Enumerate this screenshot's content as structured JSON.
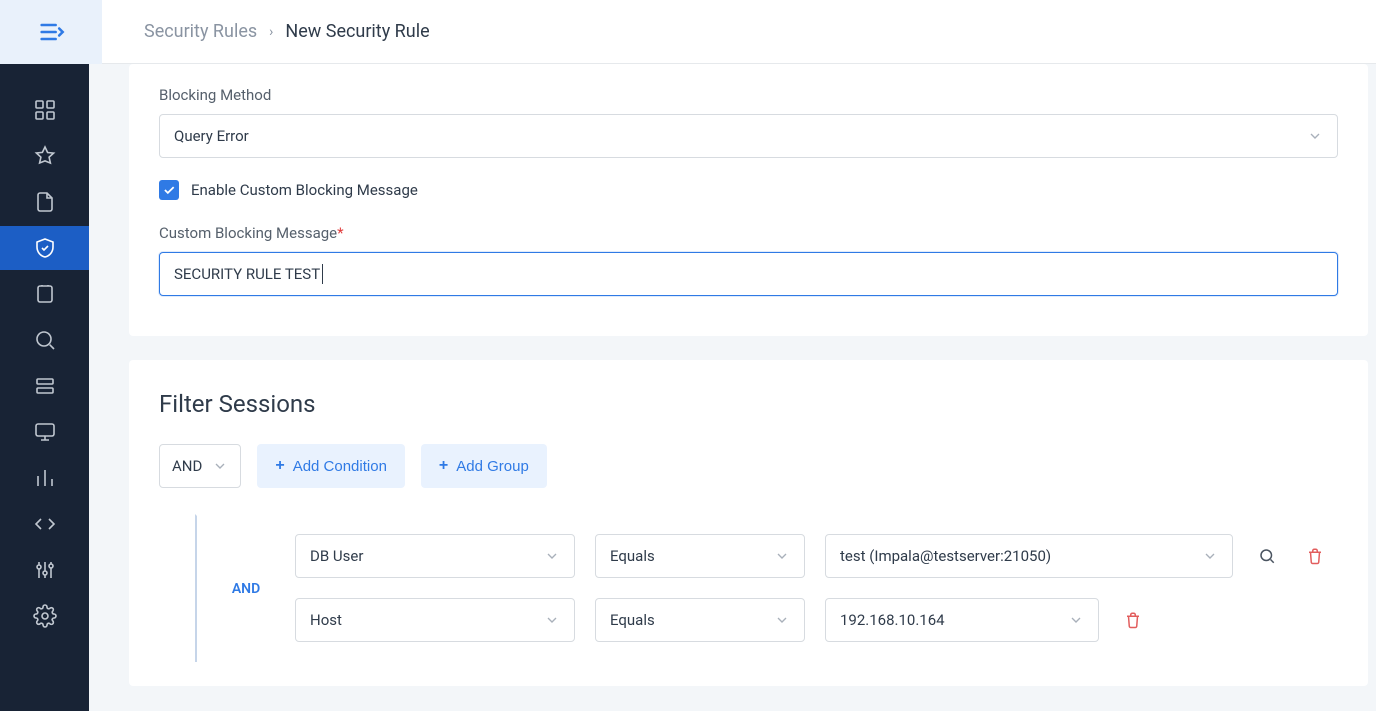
{
  "breadcrumb": {
    "parent": "Security Rules",
    "current": "New Security Rule"
  },
  "form": {
    "blocking_method_label": "Blocking Method",
    "blocking_method_value": "Query Error",
    "enable_custom_label": "Enable Custom Blocking Message",
    "custom_msg_label": "Custom Blocking Message",
    "custom_msg_value": "SECURITY RULE TEST"
  },
  "filter": {
    "title": "Filter Sessions",
    "logic_value": "AND",
    "add_condition_label": "Add Condition",
    "add_group_label": "Add Group",
    "group_operator": "AND",
    "rows": [
      {
        "field": "DB User",
        "operator": "Equals",
        "value": "test (Impala@testserver:21050)"
      },
      {
        "field": "Host",
        "operator": "Equals",
        "value": "192.168.10.164"
      }
    ]
  }
}
